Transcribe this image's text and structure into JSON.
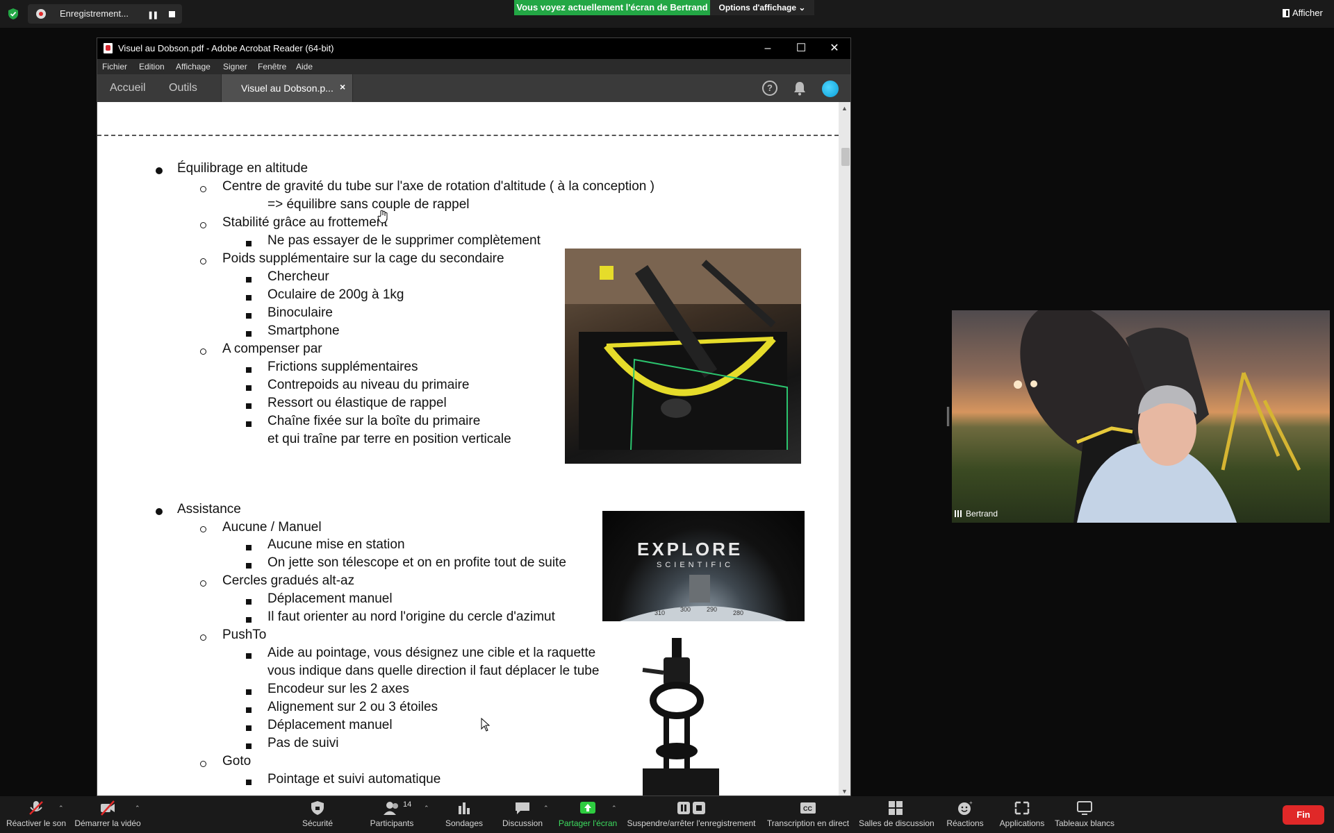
{
  "topbar": {
    "recording_label": "Enregistrement...",
    "share_banner": "Vous voyez actuellement l'écran de Bertrand",
    "view_options": "Options d'affichage",
    "show_label": "Afficher"
  },
  "acrobat": {
    "window_title": "Visuel au Dobson.pdf - Adobe Acrobat Reader (64-bit)",
    "menu": [
      "Fichier",
      "Edition",
      "Affichage",
      "Signer",
      "Fenêtre",
      "Aide"
    ],
    "tabs": {
      "home": "Accueil",
      "tools": "Outils",
      "document": "Visuel au Dobson.p..."
    }
  },
  "document": {
    "lines": [
      "Équilibrage en altitude",
      "Centre de gravité du tube sur l'axe de rotation d'altitude ( à la conception )",
      "=> équilibre sans couple de rappel",
      "Stabilité grâce au frottement",
      "Ne pas essayer de le supprimer complètement",
      "Poids supplémentaire sur la cage du secondaire",
      "Chercheur",
      "Oculaire de 200g à 1kg",
      "Binoculaire",
      "Smartphone",
      "A compenser par",
      "Frictions supplémentaires",
      "Contrepoids au niveau du primaire",
      "Ressort ou élastique de rappel",
      "Chaîne fixée sur la boîte du primaire",
      "et qui traîne par terre en position verticale",
      "Assistance",
      "Aucune / Manuel",
      "Aucune mise en station",
      "On jette son télescope et on en profite tout de suite",
      "Cercles gradués alt-az",
      "Déplacement manuel",
      "Il faut orienter au nord l'origine du cercle d'azimut",
      "PushTo",
      "Aide au pointage, vous désignez une cible et la raquette",
      "vous indique dans quelle direction il faut déplacer le tube",
      "Encodeur sur les 2 axes",
      "Alignement sur 2 ou 3 étoiles",
      "Déplacement manuel",
      "Pas de suivi",
      "Goto",
      "Pointage et suivi automatique"
    ],
    "explore_logo_line1": "EXPLORE",
    "explore_logo_line2": "SCIENTIFIC",
    "dial_ticks": [
      "310",
      "300",
      "290",
      "280"
    ]
  },
  "video": {
    "participant_name": "Bertrand"
  },
  "toolbar": {
    "unmute": "Réactiver le son",
    "start_video": "Démarrer la vidéo",
    "security": "Sécurité",
    "participants": "Participants",
    "participants_count": "14",
    "polls": "Sondages",
    "chat": "Discussion",
    "share_screen": "Partager l'écran",
    "recording": "Suspendre/arrêter l'enregistrement",
    "transcription": "Transcription en direct",
    "breakout_rooms": "Salles de discussion",
    "reactions": "Réactions",
    "apps": "Applications",
    "whiteboards": "Tableaux blancs",
    "end": "Fin"
  },
  "colors": {
    "share_banner": "#23a745",
    "end_button": "#e02828",
    "share_icon": "#2ecc40"
  }
}
